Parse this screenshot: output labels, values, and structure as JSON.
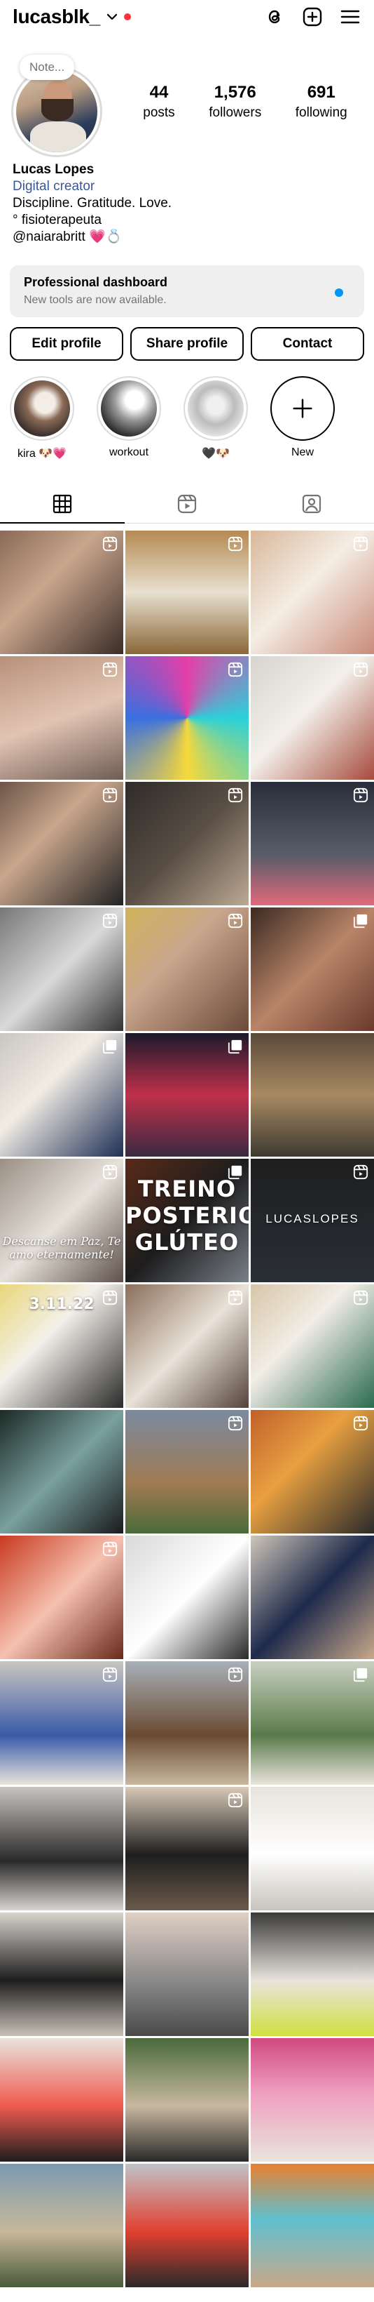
{
  "header": {
    "username": "lucasblk_",
    "icons": [
      "threads-icon",
      "create-post-icon",
      "menu-icon"
    ]
  },
  "profile": {
    "note_placeholder": "Note...",
    "stats": [
      {
        "value": "44",
        "label": "posts"
      },
      {
        "value": "1,576",
        "label": "followers"
      },
      {
        "value": "691",
        "label": "following"
      }
    ],
    "name": "Lucas Lopes",
    "category": "Digital creator",
    "bio_lines": [
      "Discipline. Gratitude. Love.",
      "° fisioterapeuta",
      "@naiarabritt 💗💍"
    ]
  },
  "dashboard": {
    "title": "Professional dashboard",
    "subtitle": "New tools are now available."
  },
  "buttons": {
    "edit": "Edit profile",
    "share": "Share profile",
    "contact": "Contact"
  },
  "highlights": [
    {
      "label": "kira 🐶💗"
    },
    {
      "label": "workout"
    },
    {
      "label": "🖤🐶"
    },
    {
      "label": "New"
    }
  ],
  "tabs": [
    "grid-tab",
    "reels-tab",
    "tagged-tab"
  ],
  "colors": {
    "accent_blue": "#0095f6",
    "link_blue": "#385898",
    "notification_red": "#ff3040",
    "dashboard_bg": "#efefef"
  },
  "grid": [
    {
      "bg": "linear-gradient(135deg,#8a6a57,#c9a68c 40%,#3b2d28)",
      "badge": "reel"
    },
    {
      "bg": "linear-gradient(180deg,#b58a52,#e8e0d0 50%,#8a6738)",
      "badge": "reel"
    },
    {
      "bg": "linear-gradient(135deg,#d9b79a,#f4ede4 45%,#c98b7a)",
      "badge": "reel"
    },
    {
      "bg": "linear-gradient(160deg,#b8907a,#e2c4b3 50%,#6e5c54)",
      "badge": "reel"
    },
    {
      "bg": "conic-gradient(#e63ea8,#2ad1d9,#f7d83b,#3a6fe0,#e63ea8)",
      "badge": "reel"
    },
    {
      "bg": "linear-gradient(135deg,#d7d4cf,#f3f0ea 45%,#a64b3c)",
      "badge": "reel"
    },
    {
      "bg": "linear-gradient(135deg,#6b5548,#c9a68c 40%,#222)",
      "badge": "reel"
    },
    {
      "bg": "linear-gradient(135deg,#2e2b29,#5a4f45 50%,#bba993)",
      "badge": "reel"
    },
    {
      "bg": "linear-gradient(180deg,#2a2d3a,#5a5d6a 60%,#e06a7a)",
      "badge": "reel"
    },
    {
      "bg": "linear-gradient(135deg,#777,#d9d9d9 50%,#333)",
      "badge": "reel"
    },
    {
      "bg": "linear-gradient(135deg,#d1b35a,#c9a68c 40%,#6b4a3a)",
      "badge": "reel"
    },
    {
      "bg": "linear-gradient(135deg,#3c2a22,#b98468 50%,#6a3a2c)",
      "badge": "carousel"
    },
    {
      "bg": "linear-gradient(135deg,#c9c6c0,#f1ece4 40%,#1e2f55)",
      "badge": "carousel"
    },
    {
      "bg": "linear-gradient(180deg,#1a1a2a,#c0304a 50%,#3a2a40)",
      "badge": "carousel"
    },
    {
      "bg": "linear-gradient(180deg,#5a4a3a,#a88a62 50%,#3d3a30)",
      "badge": "none"
    },
    {
      "bg": "linear-gradient(135deg,#9a8f85,#e6e1da 50%,#5d5048)",
      "badge": "reel",
      "overlay_script": "Descanse em Paz, Te amo eternamente!"
    },
    {
      "bg": "linear-gradient(135deg,#5a2a18,#1d1d1d 50%,#7a7f88)",
      "badge": "carousel",
      "overlay_big": "TREINO POSTERIOR GLÚTEO"
    },
    {
      "bg": "linear-gradient(180deg,#1e1e1e,#2a2f36)",
      "badge": "reel",
      "overlay_brand": "LUCASLOPES"
    },
    {
      "bg": "linear-gradient(135deg,#e9d67a,#f3f0ea 40%,#2a2a2a)",
      "badge": "reel",
      "overlay_small": "3.11.22"
    },
    {
      "bg": "linear-gradient(135deg,#8a6e5a,#e9e2d8 50%,#54433a)",
      "badge": "reel"
    },
    {
      "bg": "linear-gradient(135deg,#d7c6a8,#f2ede6 40%,#2a6b4f)",
      "badge": "reel"
    },
    {
      "bg": "linear-gradient(135deg,#1c2a24,#7aa0a0 50%,#1a1a1a)",
      "badge": "none"
    },
    {
      "bg": "linear-gradient(180deg,#7a8aa0,#a07a52 60%,#4a6a3a)",
      "badge": "reel"
    },
    {
      "bg": "linear-gradient(135deg,#c0602a,#e8a040 40%,#2a2a2a)",
      "badge": "reel"
    },
    {
      "bg": "linear-gradient(135deg,#c83a20,#f6c0b0 50%,#6a2a1a)",
      "badge": "reel"
    },
    {
      "bg": "linear-gradient(135deg,#d9d9d9,#ffffff 50%,#2a2a2a)",
      "badge": "none"
    },
    {
      "bg": "linear-gradient(135deg,#cfc6ba,#1e2a4a 50%,#c8a88a)",
      "badge": "none"
    },
    {
      "bg": "linear-gradient(180deg,#c9c6c0,#3a5aa8 60%,#e8e4dc)",
      "badge": "reel"
    },
    {
      "bg": "linear-gradient(180deg,#a8b0b8,#6a4a32 60%,#c8b8a0)",
      "badge": "reel"
    },
    {
      "bg": "linear-gradient(180deg,#c8d0c0,#5a7a4a 60%,#e8e4dc)",
      "badge": "carousel"
    },
    {
      "bg": "linear-gradient(180deg,#c8c4c0,#2a2a2a 60%,#d8d4d0)",
      "badge": "none"
    },
    {
      "bg": "linear-gradient(180deg,#d8c8b8,#1e1e1e 55%,#6a5a4a)",
      "badge": "reel"
    },
    {
      "bg": "linear-gradient(180deg,#e8e4dc,#ffffff 55%,#c8c4bc)",
      "badge": "none"
    },
    {
      "bg": "linear-gradient(180deg,#d8d4ce,#1e1e1e 55%,#c8c0b6)",
      "badge": "none"
    },
    {
      "bg": "linear-gradient(180deg,#e0cfc4,#8a8a8a 55%,#4a4a4a)",
      "badge": "none"
    },
    {
      "bg": "linear-gradient(180deg,#3a3a3a,#e8e4dc 55%,#d0e040)",
      "badge": "none"
    },
    {
      "bg": "linear-gradient(180deg,#e8e4dc,#f05a50 55%,#1e1e1e)",
      "badge": "none"
    },
    {
      "bg": "linear-gradient(180deg,#4a6a3a,#c8b8a0 55%,#2a2a2a)",
      "badge": "none"
    },
    {
      "bg": "linear-gradient(180deg,#d04a80,#f0a0c0 45%,#e8e4dc)",
      "badge": "none"
    },
    {
      "bg": "linear-gradient(180deg,#7a9ab0,#c8b89a 55%,#4a5a3a)",
      "badge": "none"
    },
    {
      "bg": "linear-gradient(180deg,#c0c4c8,#e04030 55%,#2a2a2a)",
      "badge": "none"
    },
    {
      "bg": "linear-gradient(180deg,#e88030,#60c0d0 45%,#c8a88a)",
      "badge": "none"
    }
  ]
}
